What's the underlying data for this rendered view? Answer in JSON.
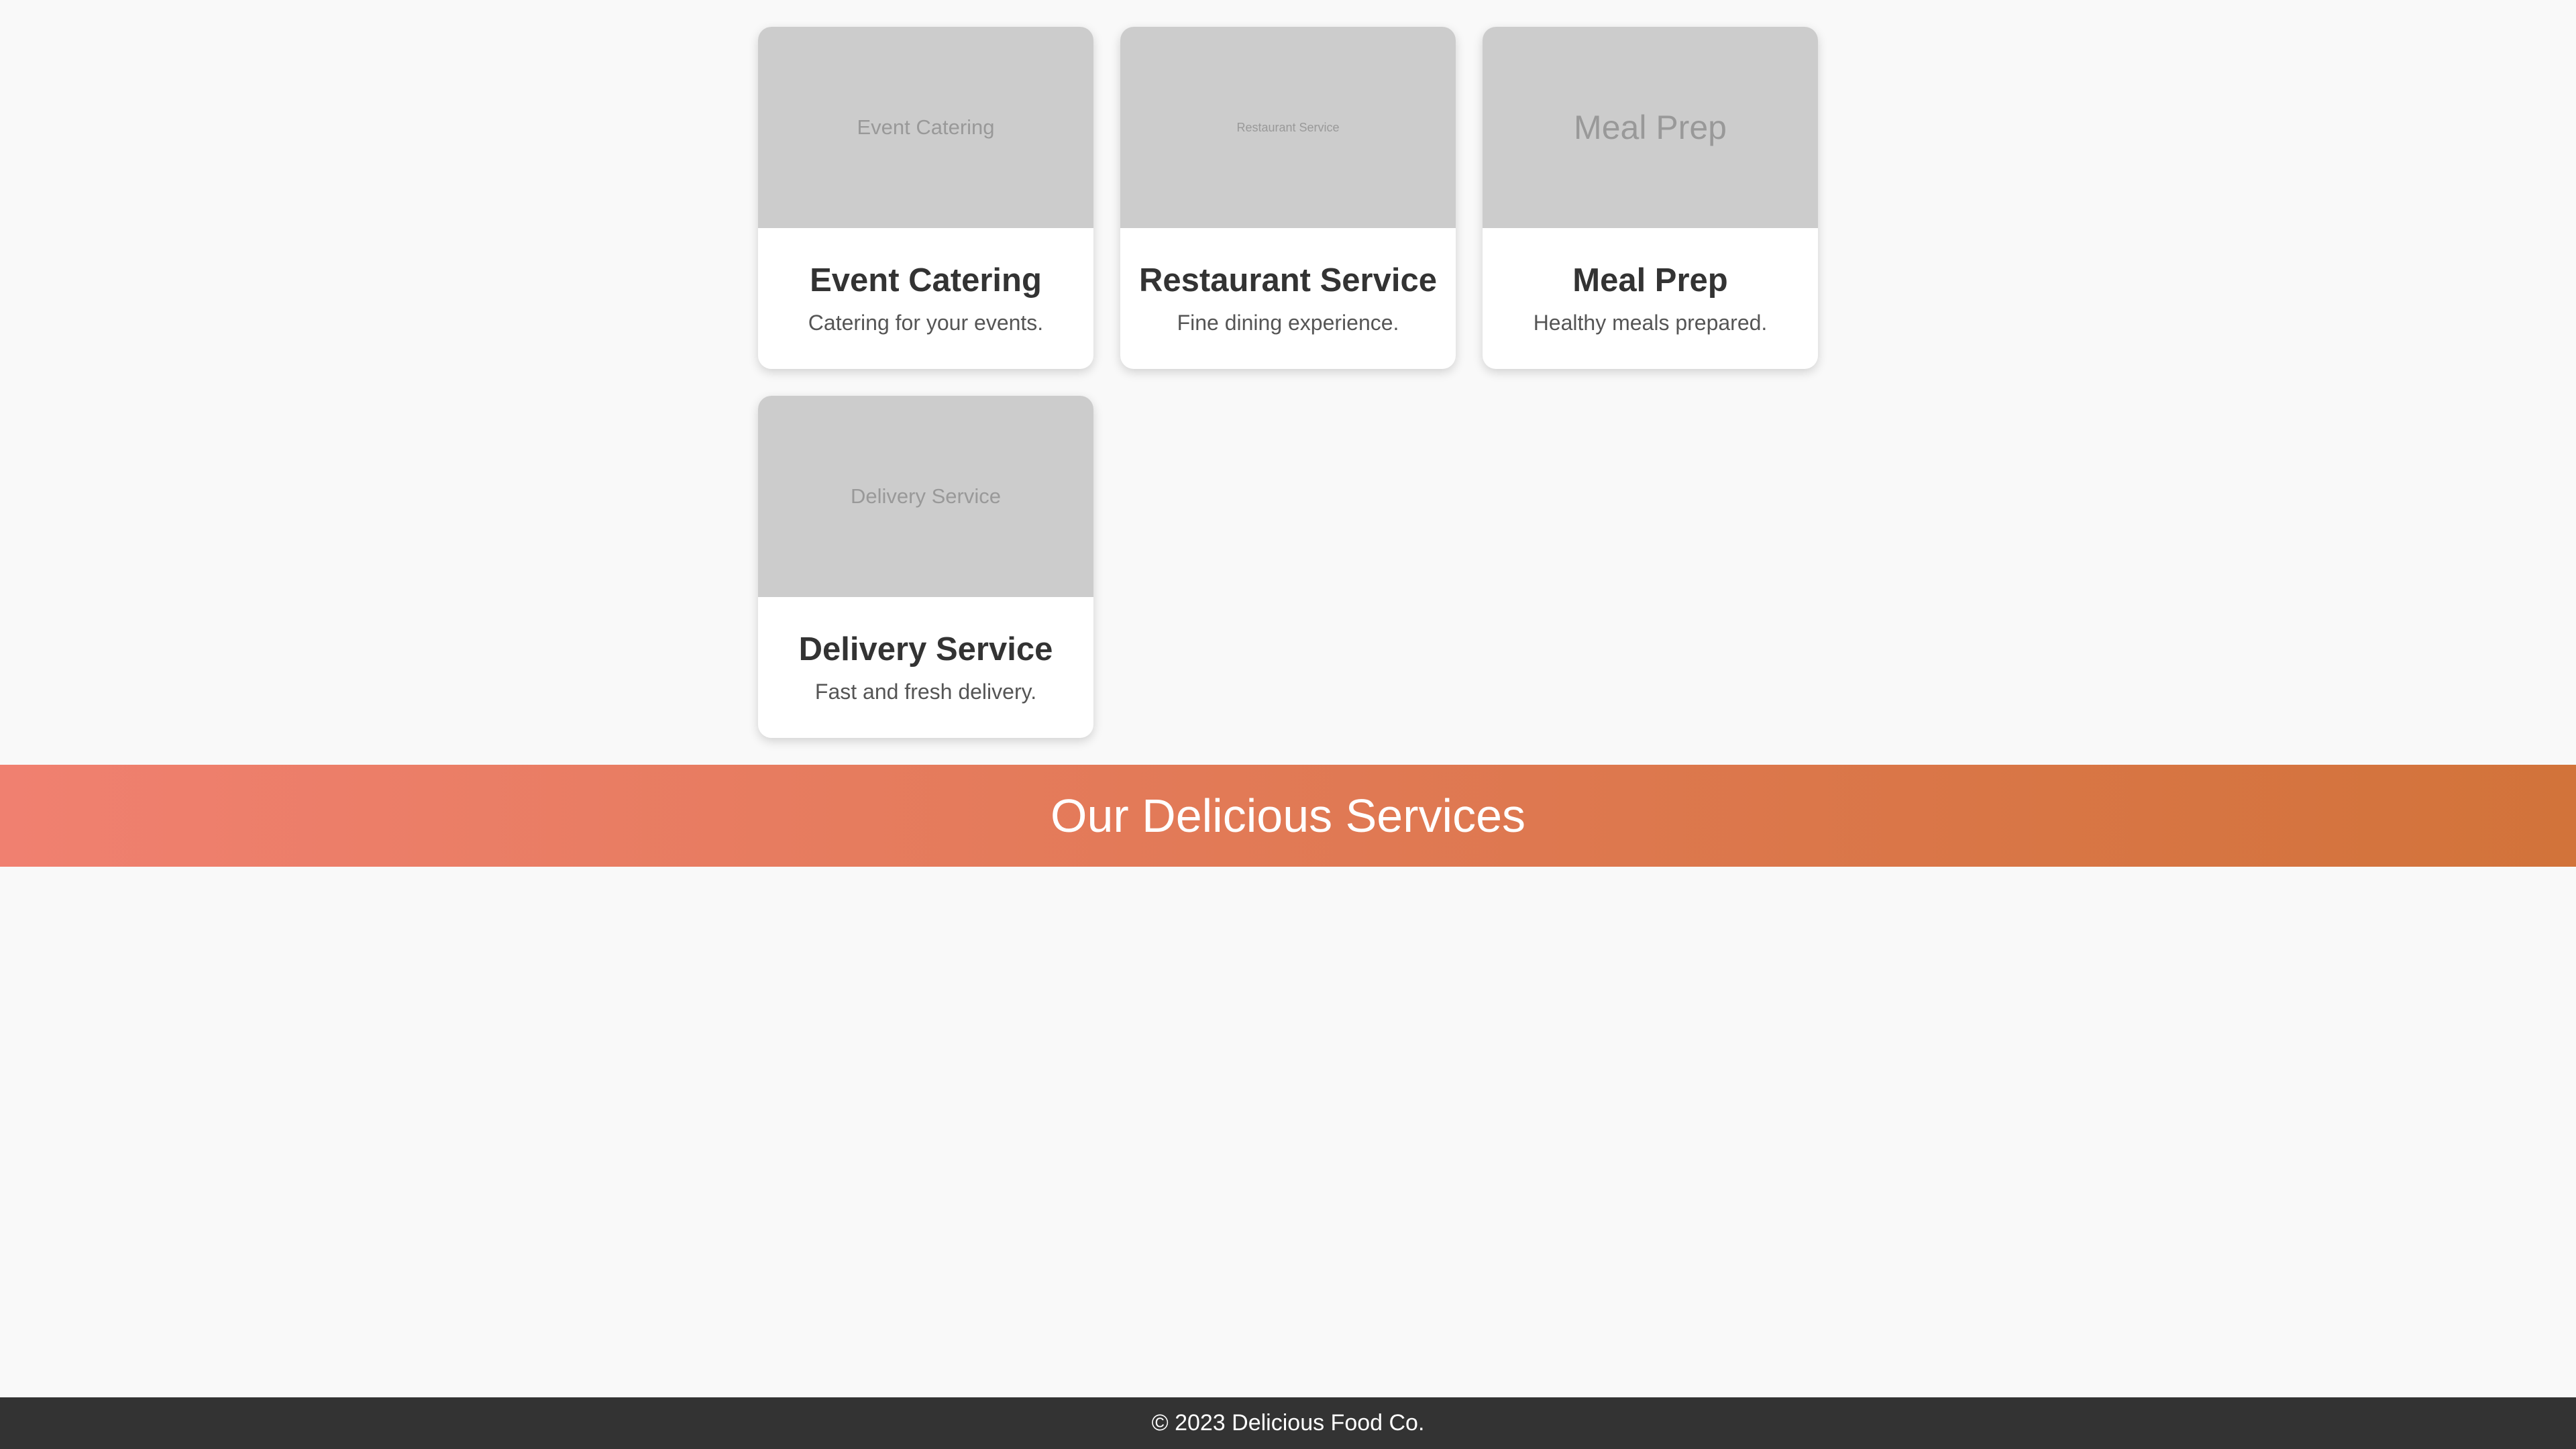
{
  "services": {
    "cards": [
      {
        "image_text": "Event Catering",
        "title": "Event Catering",
        "description": "Catering for your events."
      },
      {
        "image_text": "Restaurant Service",
        "title": "Restaurant Service",
        "description": "Fine dining experience."
      },
      {
        "image_text": "Meal Prep",
        "title": "Meal Prep",
        "description": "Healthy meals prepared."
      },
      {
        "image_text": "Delivery Service",
        "title": "Delivery Service",
        "description": "Fast and fresh delivery."
      }
    ]
  },
  "banner": {
    "title": "Our Delicious Services",
    "gradient_start": "#f08070",
    "gradient_end": "#d2733a"
  },
  "footer": {
    "text": "© 2023 Delicious Food Co."
  },
  "colors": {
    "page_background": "#f9f9f9",
    "image_placeholder": "#cccccc",
    "footer_background": "#333333"
  }
}
